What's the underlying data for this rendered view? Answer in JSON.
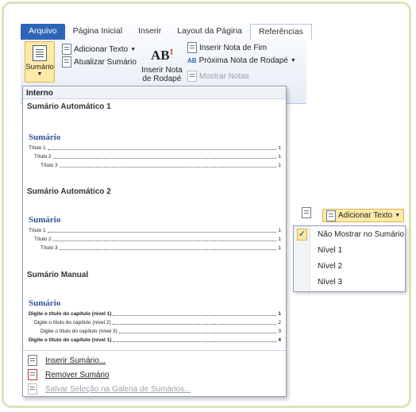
{
  "ribbon": {
    "tabs": [
      "Arquivo",
      "Página Inicial",
      "Inserir",
      "Layout da Página",
      "Referências"
    ],
    "sumario_label": "Sumário",
    "adicionar_texto": "Adicionar Texto",
    "atualizar_sumario": "Atualizar Sumário",
    "inserir_nota": [
      "Inserir Nota",
      "de Rodapé"
    ],
    "ab_label": "AB",
    "ab_sup": "1",
    "inserir_nota_fim": "Inserir Nota de Fim",
    "proxima_nota": "Próxima Nota de Rodapé",
    "mostrar_notas": "Mostrar Notas"
  },
  "gallery": {
    "header": "Interno",
    "sections": [
      {
        "title": "Sumário Automático 1",
        "toc_title": "Sumário",
        "lines": [
          {
            "text": "Título 1",
            "page": "1",
            "level": 1,
            "bold": false
          },
          {
            "text": "Título 2",
            "page": "1",
            "level": 2,
            "bold": false
          },
          {
            "text": "Título 3",
            "page": "1",
            "level": 3,
            "bold": false
          }
        ]
      },
      {
        "title": "Sumário Automático 2",
        "toc_title": "Sumário",
        "lines": [
          {
            "text": "Título 1",
            "page": "1",
            "level": 1,
            "bold": false
          },
          {
            "text": "Título 2",
            "page": "1",
            "level": 2,
            "bold": false
          },
          {
            "text": "Título 3",
            "page": "1",
            "level": 3,
            "bold": false
          }
        ]
      },
      {
        "title": "Sumário Manual",
        "toc_title": "Sumário",
        "lines": [
          {
            "text": "Digite o título do capítulo (nível 1)",
            "page": "1",
            "level": 1,
            "bold": true
          },
          {
            "text": "Digite o título do capítulo (nível 2)",
            "page": "2",
            "level": 2,
            "bold": false
          },
          {
            "text": "Digite o título do capítulo (nível 3)",
            "page": "3",
            "level": 3,
            "bold": false
          },
          {
            "text": "Digite o título do capítulo (nível 1)",
            "page": "4",
            "level": 1,
            "bold": true
          }
        ]
      }
    ],
    "actions": [
      {
        "label": "Inserir Sumário...",
        "enabled": true
      },
      {
        "label": "Remover Sumário",
        "enabled": true
      },
      {
        "label": "Salvar Seleção na Galeria de Sumários...",
        "enabled": false
      }
    ]
  },
  "add_text_menu": {
    "button_label": "Adicionar Texto",
    "items": [
      {
        "label": "Não Mostrar no Sumário",
        "checked": true
      },
      {
        "label": "Nível 1",
        "checked": false
      },
      {
        "label": "Nível 2",
        "checked": false
      },
      {
        "label": "Nível 3",
        "checked": false
      }
    ]
  },
  "colors": {
    "file_tab": "#2e64b5",
    "highlight": "#fde9a8",
    "highlight_border": "#e2b248",
    "toc_title": "#2f5597",
    "frame_border": "#d8e6b9"
  }
}
